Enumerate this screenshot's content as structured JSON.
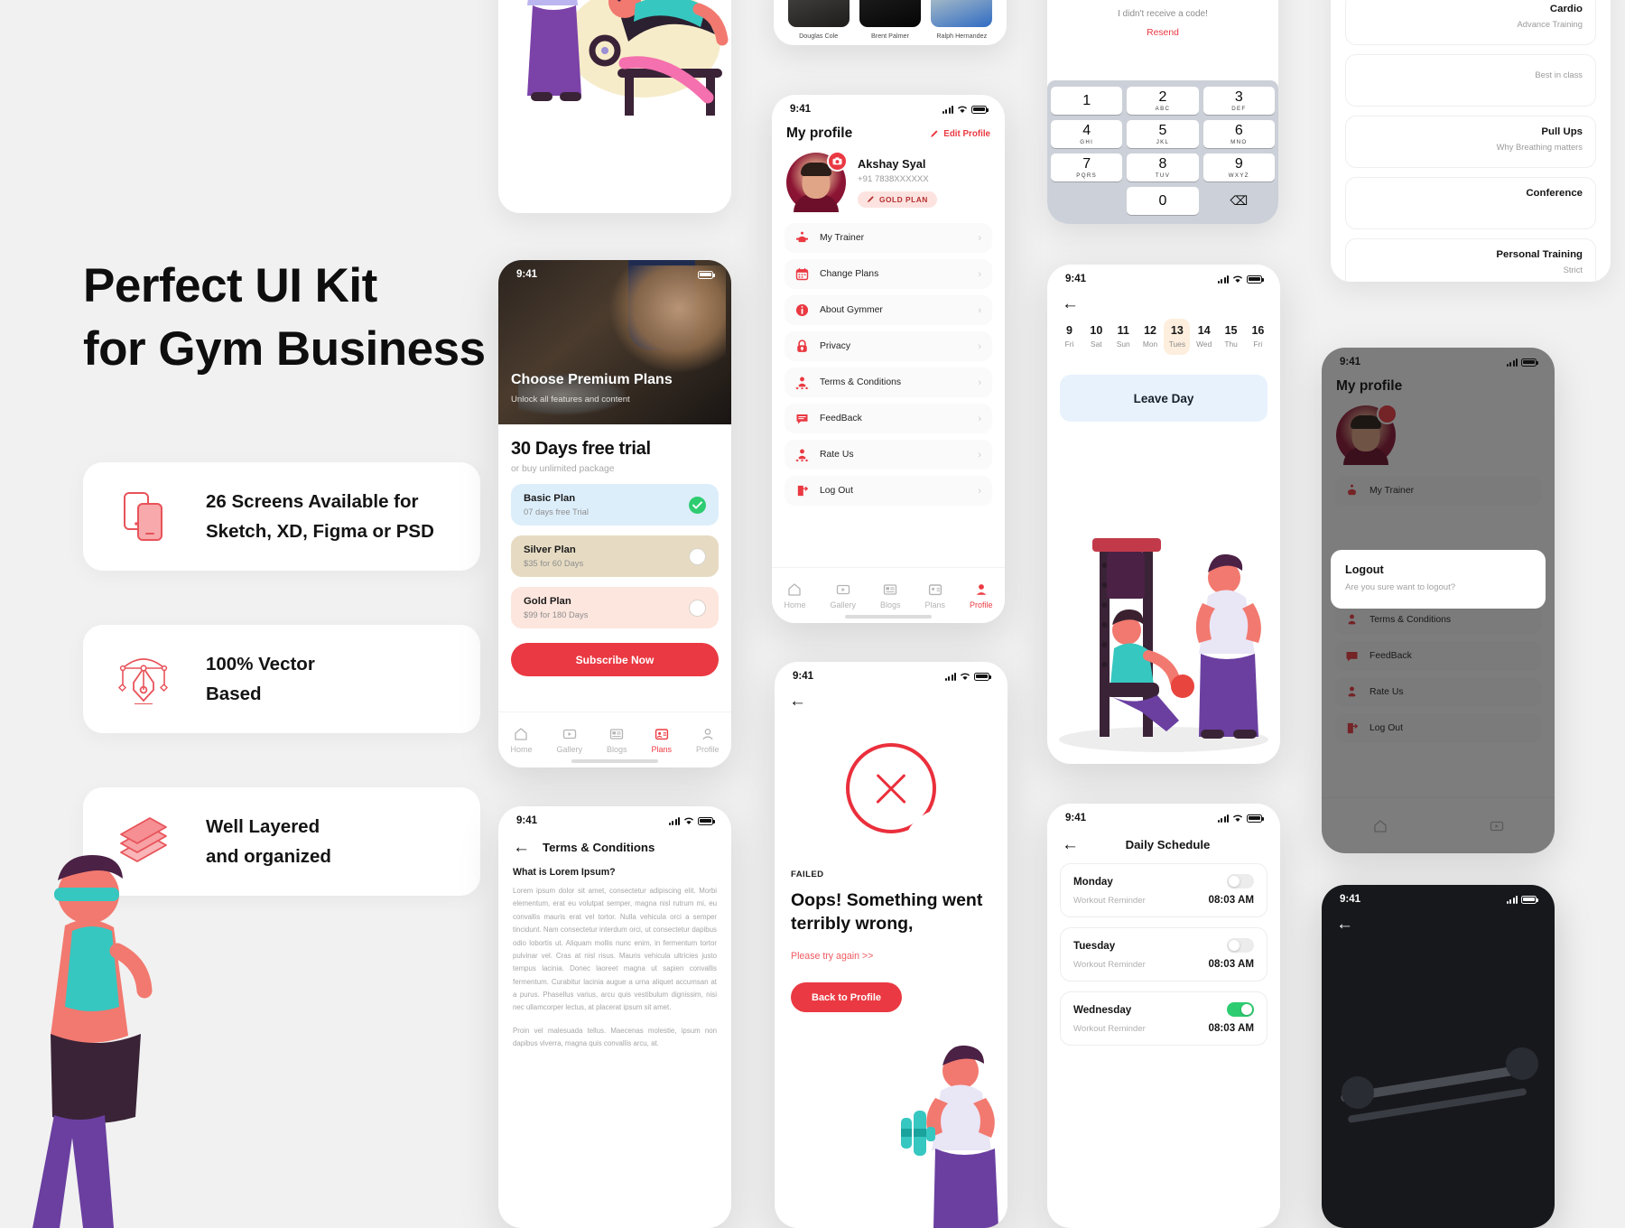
{
  "hero": {
    "line1": "Perfect UI Kit",
    "line2": "for Gym Business",
    "features": [
      {
        "icon": "phones-icon",
        "line1": "26 Screens Available for",
        "line2": "Sketch, XD, Figma or PSD"
      },
      {
        "icon": "pen-tool-icon",
        "line1": "100% Vector",
        "line2": "Based"
      },
      {
        "icon": "layers-icon",
        "line1": "Well Layered",
        "line2": "and organized"
      }
    ]
  },
  "colors": {
    "accent": "#ea3942",
    "accent_soft": "#fde3e0",
    "success": "#2ecc71",
    "bg": "#f1f1f1"
  },
  "status_time": "9:41",
  "plans_screen": {
    "hero_title": "Choose Premium Plans",
    "hero_sub": "Unlock all features and content",
    "title": "30 Days free trial",
    "subtitle": "or buy unlimited package",
    "plans": [
      {
        "name": "Basic Plan",
        "price": "07 days free Trial",
        "selected": true
      },
      {
        "name": "Silver Plan",
        "price": "$35 for 60 Days",
        "selected": false
      },
      {
        "name": "Gold Plan",
        "price": "$99 for 180 Days",
        "selected": false
      }
    ],
    "cta": "Subscribe Now",
    "tabs": [
      {
        "label": "Home",
        "icon": "home-icon",
        "active": false
      },
      {
        "label": "Gallery",
        "icon": "gallery-icon",
        "active": false
      },
      {
        "label": "Blogs",
        "icon": "blogs-icon",
        "active": false
      },
      {
        "label": "Plans",
        "icon": "plans-icon",
        "active": true
      },
      {
        "label": "Profile",
        "icon": "profile-icon",
        "active": false
      }
    ]
  },
  "profile_screen": {
    "title": "My profile",
    "edit_label": "Edit Profile",
    "user_name": "Akshay Syal",
    "user_phone": "+91 7838XXXXXX",
    "plan_badge": "GOLD PLAN",
    "menu": [
      {
        "label": "My Trainer",
        "icon": "trainer-icon"
      },
      {
        "label": "Change Plans",
        "icon": "calendar-icon"
      },
      {
        "label": "About Gymmer",
        "icon": "info-icon"
      },
      {
        "label": "Privacy",
        "icon": "lock-icon"
      },
      {
        "label": "Terms & Conditions",
        "icon": "terms-icon"
      },
      {
        "label": "FeedBack",
        "icon": "feedback-icon"
      },
      {
        "label": "Rate Us",
        "icon": "star-user-icon"
      },
      {
        "label": "Log Out",
        "icon": "logout-icon"
      }
    ],
    "tabs": [
      {
        "label": "Home",
        "icon": "home-icon",
        "active": false
      },
      {
        "label": "Gallery",
        "icon": "gallery-icon",
        "active": false
      },
      {
        "label": "Blogs",
        "icon": "blogs-icon",
        "active": false
      },
      {
        "label": "Plans",
        "icon": "plans-icon",
        "active": false
      },
      {
        "label": "Profile",
        "icon": "profile-icon",
        "active": true
      }
    ]
  },
  "trainers": [
    {
      "name": "Douglas Cole"
    },
    {
      "name": "Brent Palmer"
    },
    {
      "name": "Ralph Hernandez"
    }
  ],
  "keypad": {
    "message": "I didn't receive a code!",
    "resend": "Resend",
    "keys": [
      {
        "num": "1",
        "letters": ""
      },
      {
        "num": "2",
        "letters": "ABC"
      },
      {
        "num": "3",
        "letters": "DEF"
      },
      {
        "num": "4",
        "letters": "GHI"
      },
      {
        "num": "5",
        "letters": "JKL"
      },
      {
        "num": "6",
        "letters": "MNO"
      },
      {
        "num": "7",
        "letters": "PQRS"
      },
      {
        "num": "8",
        "letters": "TUV"
      },
      {
        "num": "9",
        "letters": "WXYZ"
      },
      {
        "num": "0",
        "letters": ""
      }
    ],
    "delete_icon": "backspace-icon"
  },
  "leave_screen": {
    "back_icon": "arrow-left-icon",
    "days": [
      {
        "num": "9",
        "name": "Fri",
        "selected": false
      },
      {
        "num": "10",
        "name": "Sat",
        "selected": false
      },
      {
        "num": "11",
        "name": "Sun",
        "selected": false
      },
      {
        "num": "12",
        "name": "Mon",
        "selected": false
      },
      {
        "num": "13",
        "name": "Tues",
        "selected": true
      },
      {
        "num": "14",
        "name": "Wed",
        "selected": false
      },
      {
        "num": "15",
        "name": "Thu",
        "selected": false
      },
      {
        "num": "16",
        "name": "Fri",
        "selected": false
      }
    ],
    "cta": "Leave Day"
  },
  "failed_screen": {
    "icon": "error-circle-icon",
    "tag": "FAILED",
    "title": "Oops! Something went terribly wrong,",
    "retry": "Please try again >>",
    "cta": "Back to Profile"
  },
  "terms_screen": {
    "title": "Terms & Conditions",
    "heading": "What is Lorem Ipsum?",
    "paragraphs": [
      "Lorem ipsum dolor sit amet, consectetur adipiscing elit. Morbi elementum, erat eu volutpat semper, magna nisl rutrum mi, eu convallis mauris erat vel tortor. Nulla vehicula orci a semper tincidunt. Nam consectetur interdum orci, ut consectetur dapibus odio lobortis ut. Aliquam mollis nunc enim, in fermentum tortor pulvinar vel. Cras at nisl risus. Mauris vehicula ultricies justo tempus lacinia. Donec laoreet magna ut sapien convallis fermentum. Curabitur lacinia augue a urna aliquet accumsan at a purus. Phasellus varius, arcu quis vestibulum dignissim, nisi nec ullamcorper lectus, at placerat ipsum sit amet.",
      "Proin vel malesuada tellus. Maecenas molestie, ipsum non dapibus viverra, magna quis convallis arcu, at."
    ]
  },
  "schedule_screen": {
    "title": "Daily Schedule",
    "rows": [
      {
        "day": "Monday",
        "reminder": "Workout Reminder",
        "time": "08:03 AM",
        "on": false
      },
      {
        "day": "Tuesday",
        "reminder": "Workout Reminder",
        "time": "08:03 AM",
        "on": false
      },
      {
        "day": "Wednesday",
        "reminder": "Workout Reminder",
        "time": "08:03 AM",
        "on": true
      }
    ]
  },
  "articles": [
    {
      "title": "Cardio",
      "sub": "Advance Training"
    },
    {
      "title": "",
      "sub": "Best in class"
    },
    {
      "title": "Pull Ups",
      "sub": "Why Breathing matters"
    },
    {
      "title": "Conference",
      "sub": ""
    },
    {
      "title": "Personal Training",
      "sub": "Strict"
    }
  ],
  "logout_modal": {
    "title": "Logout",
    "message": "Are you sure want to logout?"
  },
  "dim_profile": {
    "title": "My profile",
    "menu": [
      {
        "label": "My Trainer"
      },
      {
        "label": "Terms & Conditions"
      },
      {
        "label": "FeedBack"
      },
      {
        "label": "Rate Us"
      },
      {
        "label": "Log Out"
      }
    ]
  }
}
